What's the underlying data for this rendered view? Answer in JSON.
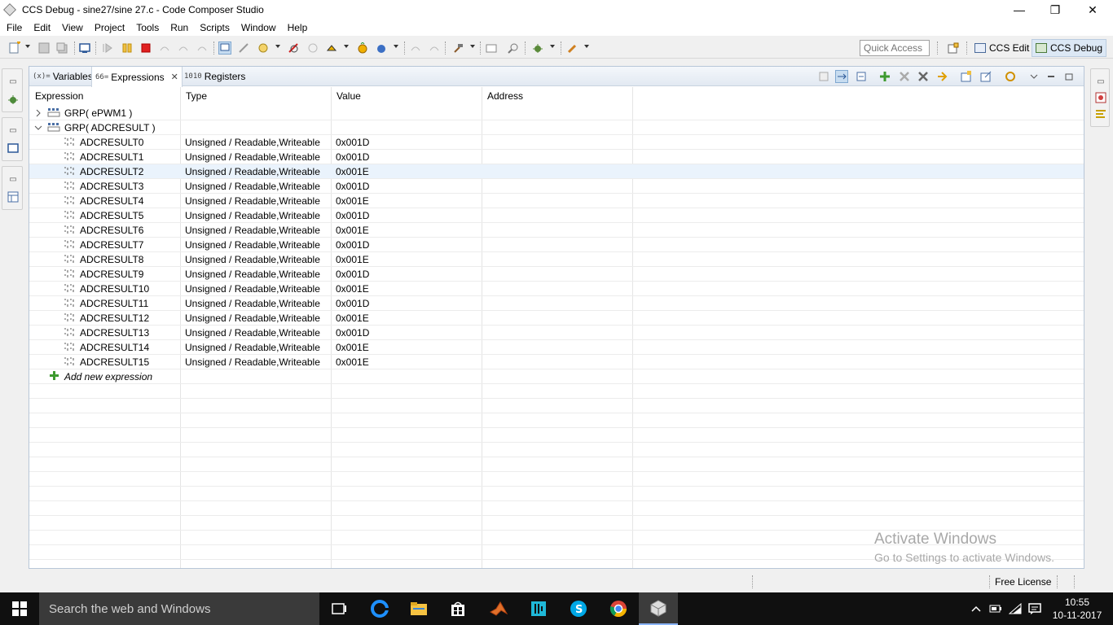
{
  "window": {
    "title": "CCS Debug - sine27/sine 27.c - Code Composer Studio",
    "minimize": "—",
    "restore": "❐",
    "close": "✕"
  },
  "menu": [
    "File",
    "Edit",
    "View",
    "Project",
    "Tools",
    "Run",
    "Scripts",
    "Window",
    "Help"
  ],
  "toolbar": {
    "quick_access_placeholder": "Quick Access",
    "perspectives": [
      {
        "label": "CCS Edit",
        "active": false
      },
      {
        "label": "CCS Debug",
        "active": true
      }
    ]
  },
  "view": {
    "tabs": [
      {
        "icon": "(x)=",
        "label": "Variables"
      },
      {
        "icon": "66=",
        "label": "Expressions"
      },
      {
        "icon": "1010",
        "label": "Registers"
      }
    ],
    "columns": [
      "Expression",
      "Type",
      "Value",
      "Address"
    ],
    "groups": [
      {
        "label": "GRP( ePWM1 )",
        "expanded": false
      },
      {
        "label": "GRP( ADCRESULT )",
        "expanded": true
      }
    ],
    "registers": [
      {
        "name": "ADCRESULT0",
        "type": "Unsigned / Readable,Writeable",
        "value": "0x001D"
      },
      {
        "name": "ADCRESULT1",
        "type": "Unsigned / Readable,Writeable",
        "value": "0x001D"
      },
      {
        "name": "ADCRESULT2",
        "type": "Unsigned / Readable,Writeable",
        "value": "0x001E"
      },
      {
        "name": "ADCRESULT3",
        "type": "Unsigned / Readable,Writeable",
        "value": "0x001D"
      },
      {
        "name": "ADCRESULT4",
        "type": "Unsigned / Readable,Writeable",
        "value": "0x001E"
      },
      {
        "name": "ADCRESULT5",
        "type": "Unsigned / Readable,Writeable",
        "value": "0x001D"
      },
      {
        "name": "ADCRESULT6",
        "type": "Unsigned / Readable,Writeable",
        "value": "0x001E"
      },
      {
        "name": "ADCRESULT7",
        "type": "Unsigned / Readable,Writeable",
        "value": "0x001D"
      },
      {
        "name": "ADCRESULT8",
        "type": "Unsigned / Readable,Writeable",
        "value": "0x001E"
      },
      {
        "name": "ADCRESULT9",
        "type": "Unsigned / Readable,Writeable",
        "value": "0x001D"
      },
      {
        "name": "ADCRESULT10",
        "type": "Unsigned / Readable,Writeable",
        "value": "0x001E"
      },
      {
        "name": "ADCRESULT11",
        "type": "Unsigned / Readable,Writeable",
        "value": "0x001D"
      },
      {
        "name": "ADCRESULT12",
        "type": "Unsigned / Readable,Writeable",
        "value": "0x001E"
      },
      {
        "name": "ADCRESULT13",
        "type": "Unsigned / Readable,Writeable",
        "value": "0x001D"
      },
      {
        "name": "ADCRESULT14",
        "type": "Unsigned / Readable,Writeable",
        "value": "0x001E"
      },
      {
        "name": "ADCRESULT15",
        "type": "Unsigned / Readable,Writeable",
        "value": "0x001E"
      }
    ],
    "selected_register": "ADCRESULT2",
    "add_new_label": "Add new expression"
  },
  "watermark": {
    "line1": "Activate Windows",
    "line2": "Go to Settings to activate Windows."
  },
  "statusbar": {
    "license": "Free License"
  },
  "taskbar": {
    "search_placeholder": "Search the web and Windows",
    "time": "10:55",
    "date": "10-11-2017"
  },
  "colors": {
    "selection": "#eaf3fc",
    "accent": "#0078d7",
    "taskbar": "#101010"
  }
}
